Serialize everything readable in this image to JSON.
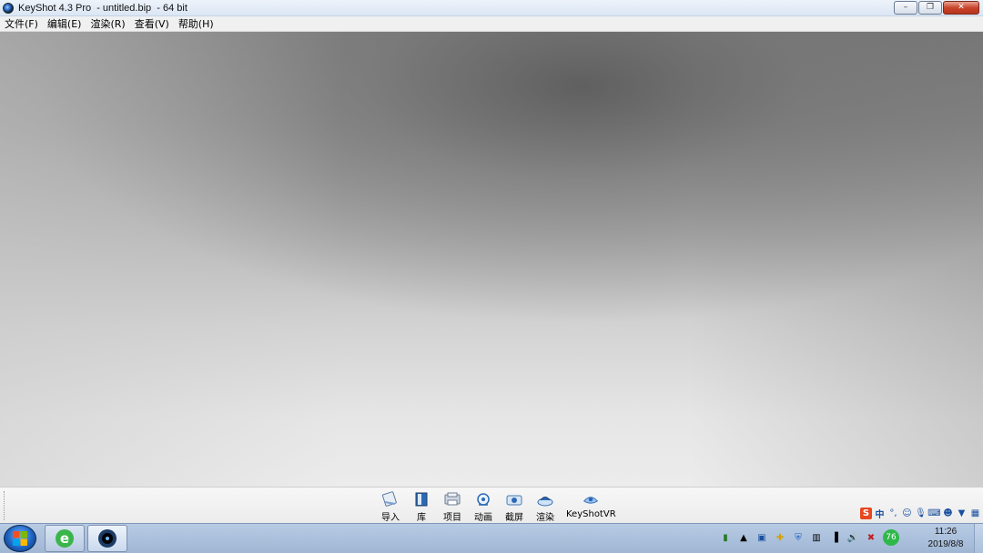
{
  "window": {
    "title": "KeyShot 4.3 Pro  - untitled.bip  - 64 bit",
    "controls": [
      "minimize",
      "restore",
      "close"
    ]
  },
  "menubar": {
    "items": [
      "文件(F)",
      "编辑(E)",
      "渲染(R)",
      "查看(V)",
      "帮助(H)"
    ]
  },
  "toolbar": {
    "tools": [
      {
        "label": "导入",
        "icon": "import-icon"
      },
      {
        "label": "库",
        "icon": "library-icon"
      },
      {
        "label": "项目",
        "icon": "project-icon"
      },
      {
        "label": "动画",
        "icon": "animation-icon"
      },
      {
        "label": "截屏",
        "icon": "screenshot-icon"
      },
      {
        "label": "渲染",
        "icon": "render-icon"
      },
      {
        "label": "KeyShotVR",
        "icon": "keyshotvr-icon"
      }
    ]
  },
  "ime": {
    "mode": "中",
    "icons": [
      "sogou-icon",
      "punctuation-icon",
      "emoji-icon",
      "microphone-icon",
      "keyboard-icon",
      "user-icon",
      "skin-icon",
      "toolbox-icon"
    ]
  },
  "taskbar": {
    "tray_badge": "76",
    "time": "11:26",
    "date": "2019/8/8"
  }
}
